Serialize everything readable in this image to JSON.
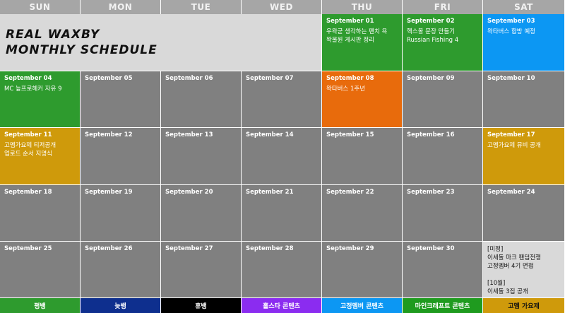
{
  "weekdays": [
    "SUN",
    "MON",
    "TUE",
    "WED",
    "THU",
    "FRI",
    "SAT"
  ],
  "title": {
    "line1": "REAL WAXBY",
    "line2": "MONTHLY SCHEDULE"
  },
  "days": {
    "sep01": {
      "date": "September 01",
      "event": "우왁굳 생각하는 팬치 욕\n왁물원 게시판 정리"
    },
    "sep02": {
      "date": "September 02",
      "event": "헥스볼 문장 만들기\nRussian Fishing 4"
    },
    "sep03": {
      "date": "September 03",
      "event": "왁타버스 합방 예정"
    },
    "sep04": {
      "date": "September 04",
      "event": "MC 늪프로헤커 자유 9"
    },
    "sep05": {
      "date": "September 05",
      "event": ""
    },
    "sep06": {
      "date": "September 06",
      "event": ""
    },
    "sep07": {
      "date": "September 07",
      "event": ""
    },
    "sep08": {
      "date": "September 08",
      "event": "왁타버스 1주년"
    },
    "sep09": {
      "date": "September 09",
      "event": ""
    },
    "sep10": {
      "date": "September 10",
      "event": ""
    },
    "sep11": {
      "date": "September 11",
      "event": "고멤가요제 티저공개\n업로드 순서 지명식"
    },
    "sep12": {
      "date": "September 12",
      "event": ""
    },
    "sep13": {
      "date": "September 13",
      "event": ""
    },
    "sep14": {
      "date": "September 14",
      "event": ""
    },
    "sep15": {
      "date": "September 15",
      "event": ""
    },
    "sep16": {
      "date": "September 16",
      "event": ""
    },
    "sep17": {
      "date": "September 17",
      "event": "고멤가요제 뮤비 공개"
    },
    "sep18": {
      "date": "September 18",
      "event": ""
    },
    "sep19": {
      "date": "September 19",
      "event": ""
    },
    "sep20": {
      "date": "September 20",
      "event": ""
    },
    "sep21": {
      "date": "September 21",
      "event": ""
    },
    "sep22": {
      "date": "September 22",
      "event": ""
    },
    "sep23": {
      "date": "September 23",
      "event": ""
    },
    "sep24": {
      "date": "September 24",
      "event": ""
    },
    "sep25": {
      "date": "September 25",
      "event": ""
    },
    "sep26": {
      "date": "September 26",
      "event": ""
    },
    "sep27": {
      "date": "September 27",
      "event": ""
    },
    "sep28": {
      "date": "September 28",
      "event": ""
    },
    "sep29": {
      "date": "September 29",
      "event": ""
    },
    "sep30": {
      "date": "September 30",
      "event": ""
    }
  },
  "notes": {
    "text": "[미정]\n이세돌 마크 팬덤전쟁\n고정멤버 4기 면접\n\n[10월]\n이세돌 3집 공개"
  },
  "legend": {
    "normal": "평뱅",
    "late": "늦뱅",
    "off": "휴뱅",
    "collab": "홀스타 콘텐츠",
    "fixed": "고정멤버 콘텐츠",
    "minecraft": "마인크래프트 콘텐츠",
    "gomem": "고멤 가요제"
  },
  "colors": {
    "normal": "#2e9b2e",
    "late": "#0e2f8e",
    "off": "#000000",
    "collab": "#8b2cf0",
    "fixed": "#0c97f3",
    "minecraft": "#1f9b1f",
    "gomem": "#cf9a0b",
    "empty": "#808080",
    "anniversary": "#e86b0c"
  }
}
